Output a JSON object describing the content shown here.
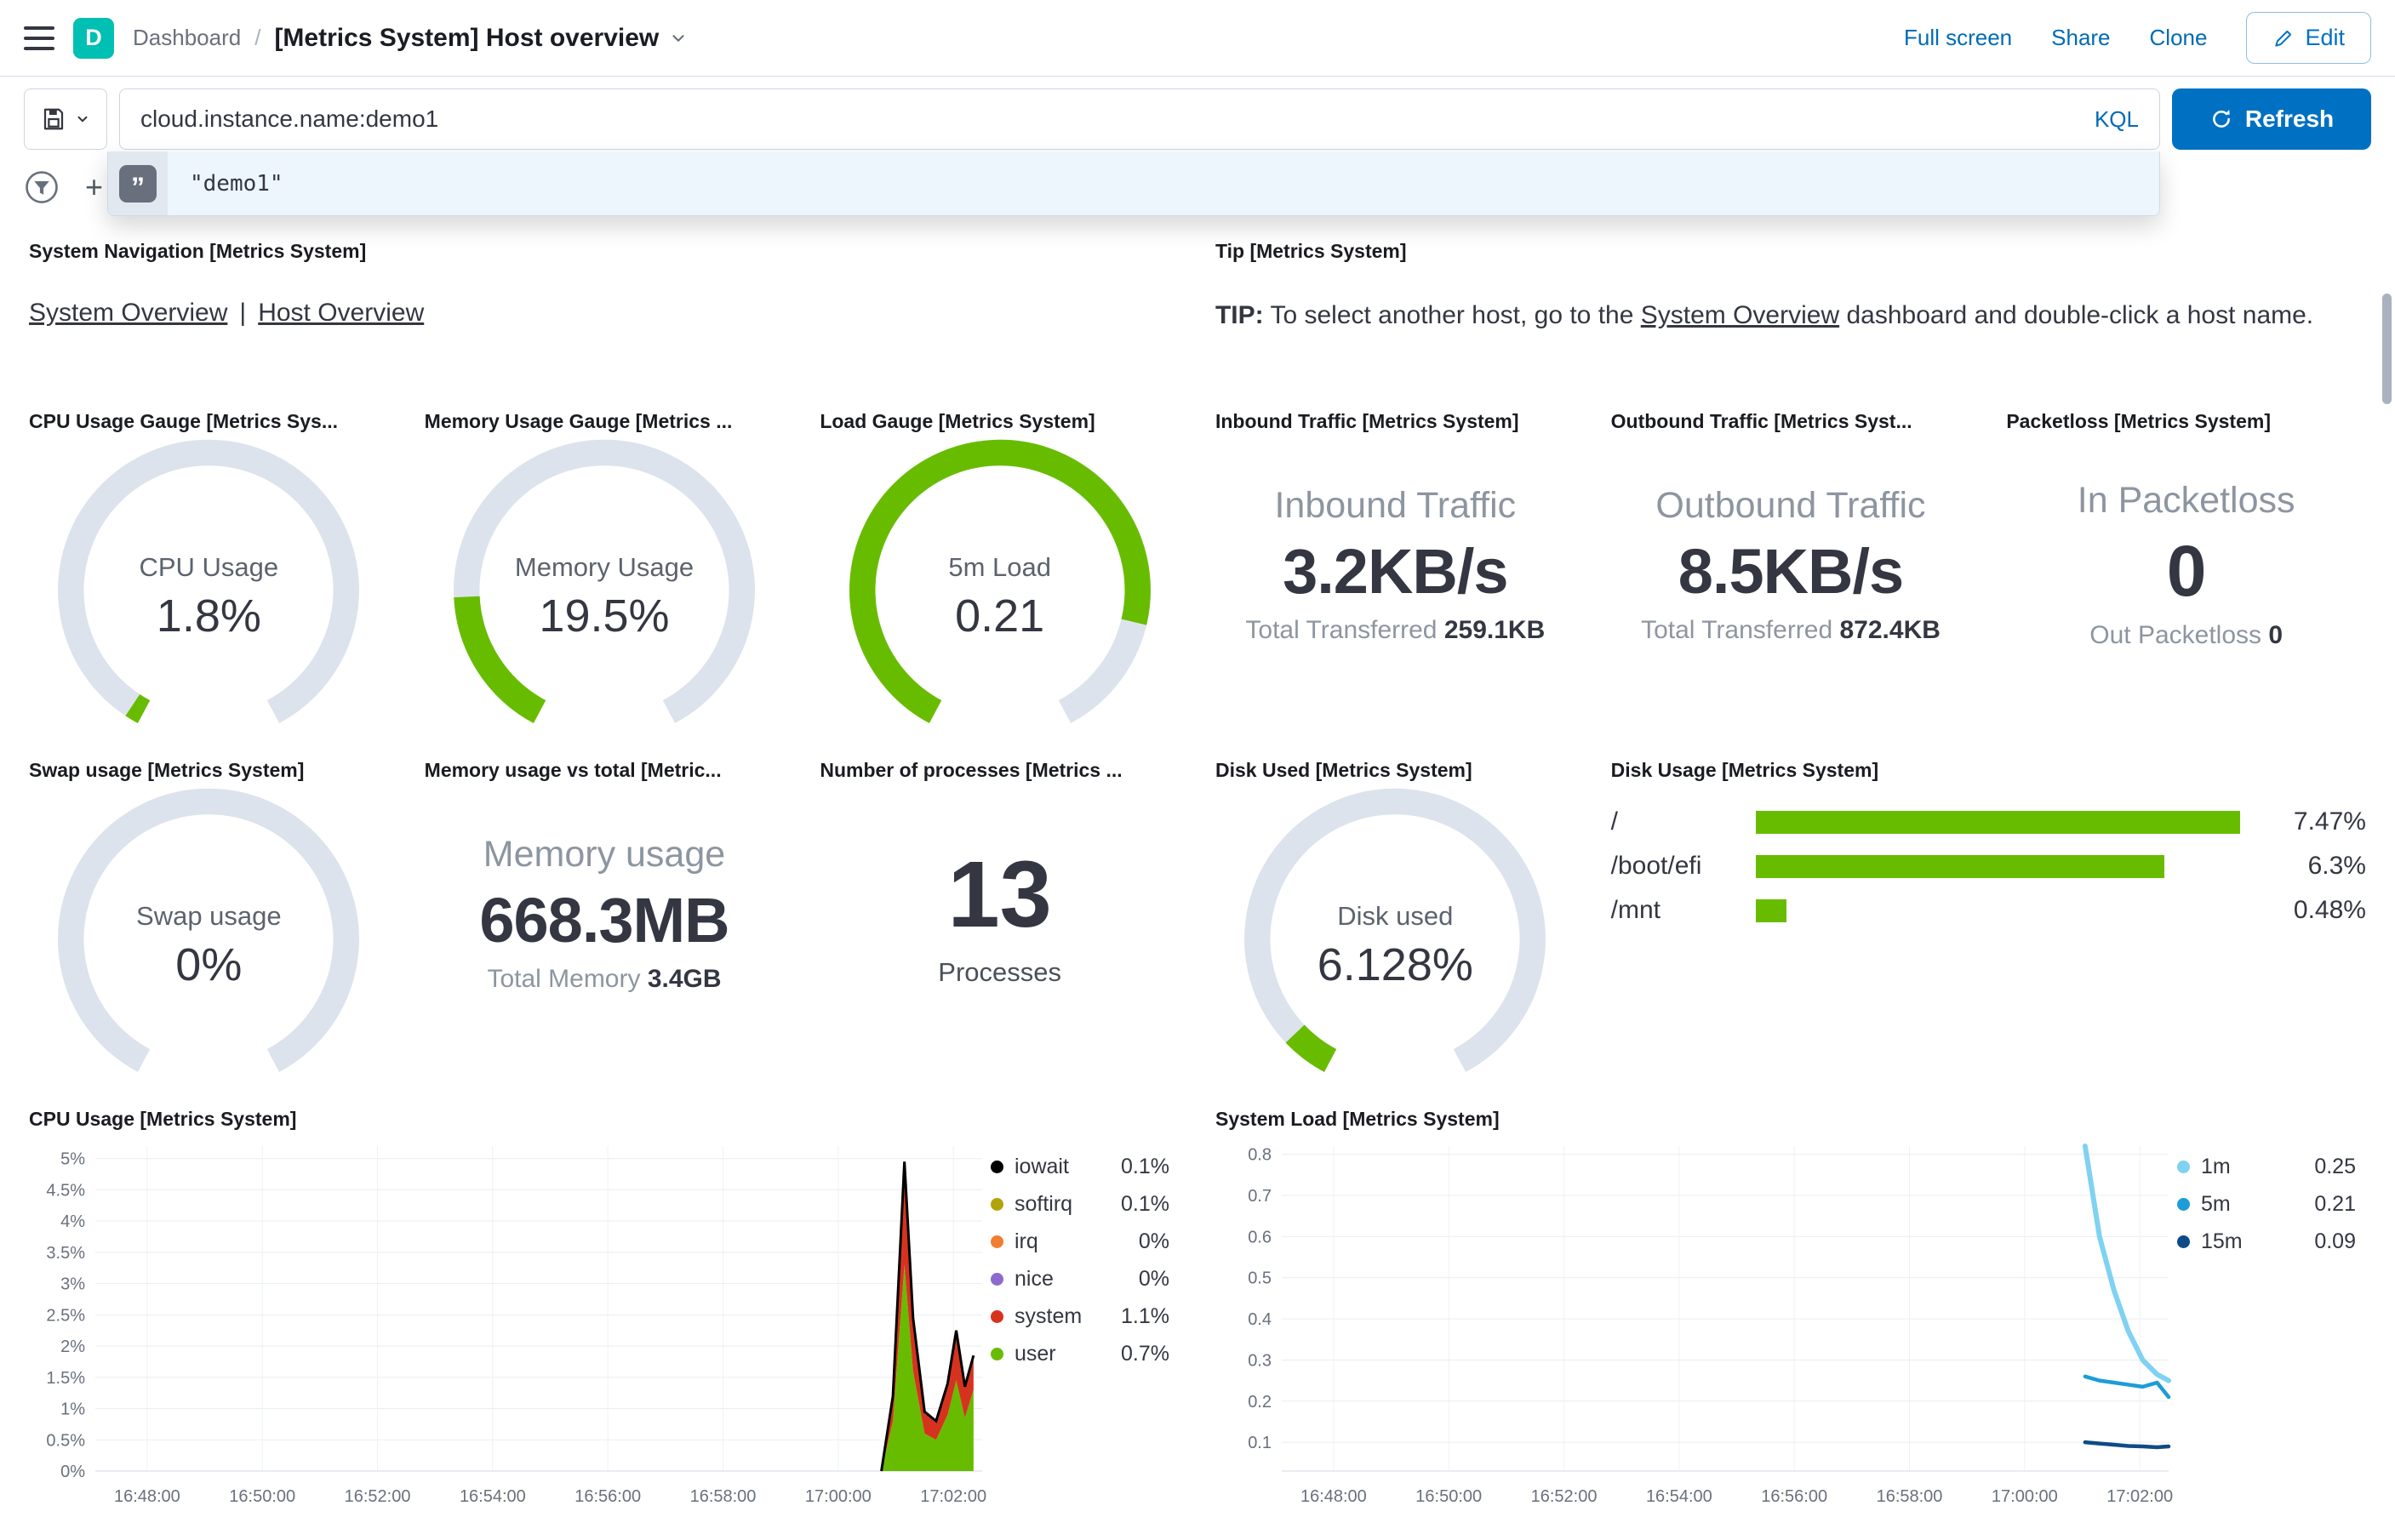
{
  "colors": {
    "primary": "#0071c2",
    "link": "#006bb4",
    "accent_green": "#68bc00",
    "gauge_track": "#dde3ec",
    "badge": "#00bfb3"
  },
  "header": {
    "app_badge": "D",
    "breadcrumb_root": "Dashboard",
    "breadcrumb_sep": "/",
    "title": "[Metrics System] Host overview",
    "full_screen": "Full screen",
    "share": "Share",
    "clone": "Clone",
    "edit": "Edit"
  },
  "query_bar": {
    "query": "cloud.instance.name:demo1",
    "kql_label": "KQL",
    "refresh_label": "Refresh",
    "suggestion_value": "\"demo1\"",
    "add_filter_plus": "+"
  },
  "panels": {
    "system_navigation": {
      "title": "System Navigation [Metrics System]",
      "link1": "System Overview",
      "sep": "|",
      "link2": "Host Overview"
    },
    "tip": {
      "title": "Tip [Metrics System]",
      "label": "TIP:",
      "before": " To select another host, go to the ",
      "link": "System Overview",
      "after": " dashboard and double-click a host name."
    },
    "gauges": [
      {
        "title": "CPU Usage Gauge [Metrics Sys...",
        "label": "CPU Usage",
        "value": "1.8%",
        "fraction": 0.018
      },
      {
        "title": "Memory Usage Gauge [Metrics ...",
        "label": "Memory Usage",
        "value": "19.5%",
        "fraction": 0.195
      },
      {
        "title": "Load Gauge [Metrics System]",
        "label": "5m Load",
        "value": "0.21",
        "fraction": 0.84
      },
      {
        "title": "Swap usage [Metrics System]",
        "label": "Swap usage",
        "value": "0%",
        "fraction": 0
      },
      {
        "title": "Disk Used [Metrics System]",
        "label": "Disk used",
        "value": "6.128%",
        "fraction": 0.061
      }
    ],
    "inbound": {
      "title": "Inbound Traffic [Metrics System]",
      "label": "Inbound Traffic",
      "value": "3.2KB/s",
      "sub_label": "Total Transferred ",
      "sub_value": "259.1KB"
    },
    "outbound": {
      "title": "Outbound Traffic [Metrics Syst...",
      "label": "Outbound Traffic",
      "value": "8.5KB/s",
      "sub_label": "Total Transferred ",
      "sub_value": "872.4KB"
    },
    "packetloss": {
      "title": "Packetloss [Metrics System]",
      "label": "In Packetloss",
      "value": "0",
      "sub_label": "Out Packetloss ",
      "sub_value": "0"
    },
    "memory_total": {
      "title": "Memory usage vs total [Metric...",
      "label": "Memory usage",
      "value": "668.3MB",
      "sub_label": "Total Memory ",
      "sub_value": "3.4GB"
    },
    "processes": {
      "title": "Number of processes [Metrics ...",
      "value": "13",
      "label": "Processes"
    },
    "disk_usage": {
      "title": "Disk Usage [Metrics System]",
      "max": 7.47,
      "rows": [
        {
          "label": "/",
          "value": "7.47%",
          "pct": 7.47
        },
        {
          "label": "/boot/efi",
          "value": "6.3%",
          "pct": 6.3
        },
        {
          "label": "/mnt",
          "value": "0.48%",
          "pct": 0.48
        }
      ]
    }
  },
  "chart_data": [
    {
      "type": "area",
      "title": "CPU Usage [Metrics System]",
      "stacked": true,
      "x_unit": "minutes since 16:48:00",
      "xlim": [
        -0.9,
        14.5
      ],
      "ylim": [
        0,
        5.2
      ],
      "x_ticks": [
        {
          "v": 0,
          "label": "16:48:00"
        },
        {
          "v": 2,
          "label": "16:50:00"
        },
        {
          "v": 4,
          "label": "16:52:00"
        },
        {
          "v": 6,
          "label": "16:54:00"
        },
        {
          "v": 8,
          "label": "16:56:00"
        },
        {
          "v": 10,
          "label": "16:58:00"
        },
        {
          "v": 12,
          "label": "17:00:00"
        },
        {
          "v": 14,
          "label": "17:02:00"
        }
      ],
      "y_ticks": [
        {
          "v": 0,
          "label": "0%"
        },
        {
          "v": 0.5,
          "label": "0.5%"
        },
        {
          "v": 1,
          "label": "1%"
        },
        {
          "v": 1.5,
          "label": "1.5%"
        },
        {
          "v": 2,
          "label": "2%"
        },
        {
          "v": 2.5,
          "label": "2.5%"
        },
        {
          "v": 3,
          "label": "3%"
        },
        {
          "v": 3.5,
          "label": "3.5%"
        },
        {
          "v": 4,
          "label": "4%"
        },
        {
          "v": 4.5,
          "label": "4.5%"
        },
        {
          "v": 5,
          "label": "5%"
        }
      ],
      "x": [
        12.75,
        12.95,
        13.15,
        13.3,
        13.5,
        13.7,
        13.9,
        14.05,
        14.2,
        14.35
      ],
      "series": [
        {
          "name": "user",
          "color": "#68bc00",
          "values": [
            0,
            0.8,
            3.3,
            1.6,
            0.6,
            0.5,
            0.9,
            1.45,
            0.85,
            1.3
          ]
        },
        {
          "name": "system",
          "color": "#d6331f",
          "values": [
            0,
            0.4,
            1.65,
            0.85,
            0.35,
            0.3,
            0.5,
            0.8,
            0.5,
            0.55
          ]
        }
      ],
      "outline_color": "#000000",
      "legend": [
        {
          "name": "iowait",
          "value": "0.1%",
          "color": "#000000"
        },
        {
          "name": "softirq",
          "value": "0.1%",
          "color": "#b0a40a"
        },
        {
          "name": "irq",
          "value": "0%",
          "color": "#ef7e32"
        },
        {
          "name": "nice",
          "value": "0%",
          "color": "#8d6ad0"
        },
        {
          "name": "system",
          "value": "1.1%",
          "color": "#d6331f"
        },
        {
          "name": "user",
          "value": "0.7%",
          "color": "#68bc00"
        }
      ]
    },
    {
      "type": "line",
      "title": "System Load [Metrics System]",
      "x_unit": "minutes since 16:48:00",
      "xlim": [
        -0.9,
        14.5
      ],
      "ylim": [
        0.03,
        0.82
      ],
      "x_ticks": [
        {
          "v": 0,
          "label": "16:48:00"
        },
        {
          "v": 2,
          "label": "16:50:00"
        },
        {
          "v": 4,
          "label": "16:52:00"
        },
        {
          "v": 6,
          "label": "16:54:00"
        },
        {
          "v": 8,
          "label": "16:56:00"
        },
        {
          "v": 10,
          "label": "16:58:00"
        },
        {
          "v": 12,
          "label": "17:00:00"
        },
        {
          "v": 14,
          "label": "17:02:00"
        }
      ],
      "y_ticks": [
        {
          "v": 0.1,
          "label": "0.1"
        },
        {
          "v": 0.2,
          "label": "0.2"
        },
        {
          "v": 0.3,
          "label": "0.3"
        },
        {
          "v": 0.4,
          "label": "0.4"
        },
        {
          "v": 0.5,
          "label": "0.5"
        },
        {
          "v": 0.6,
          "label": "0.6"
        },
        {
          "v": 0.7,
          "label": "0.7"
        },
        {
          "v": 0.8,
          "label": "0.8"
        }
      ],
      "x": [
        13.05,
        13.3,
        13.55,
        13.8,
        14.05,
        14.3,
        14.5
      ],
      "series": [
        {
          "name": "1m",
          "color": "#7fd2f1",
          "width": 6,
          "values": [
            0.82,
            0.6,
            0.47,
            0.37,
            0.3,
            0.265,
            0.25
          ]
        },
        {
          "name": "5m",
          "color": "#1c9dd6",
          "width": 4.5,
          "values": [
            0.26,
            0.25,
            0.245,
            0.24,
            0.235,
            0.245,
            0.21
          ]
        },
        {
          "name": "15m",
          "color": "#0e4a86",
          "width": 4.5,
          "values": [
            0.1,
            0.097,
            0.094,
            0.091,
            0.09,
            0.088,
            0.09
          ]
        }
      ],
      "legend": [
        {
          "name": "1m",
          "value": "0.25",
          "color": "#7fd2f1"
        },
        {
          "name": "5m",
          "value": "0.21",
          "color": "#1c9dd6"
        },
        {
          "name": "15m",
          "value": "0.09",
          "color": "#0e4a86"
        }
      ]
    }
  ]
}
